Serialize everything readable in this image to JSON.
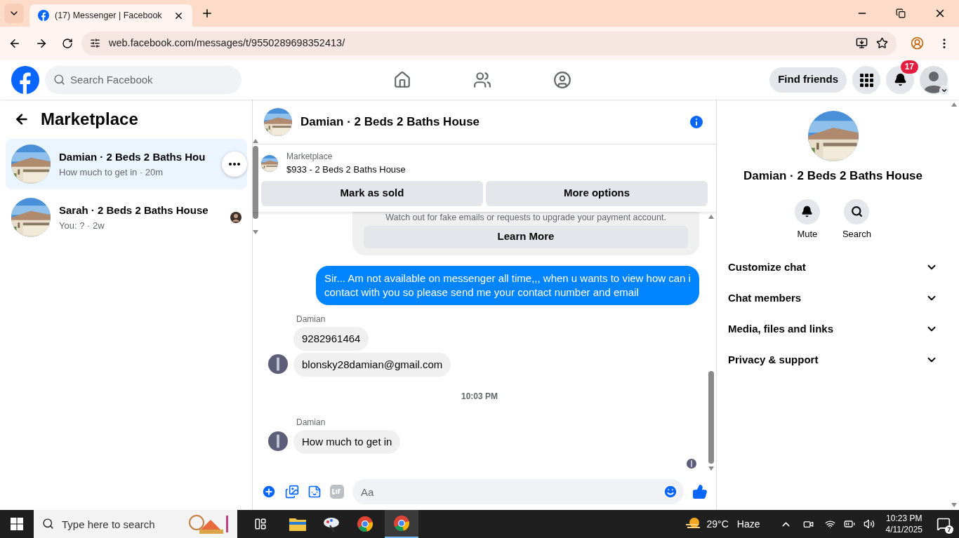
{
  "browser": {
    "tab_title": "(17) Messenger | Facebook",
    "url": "web.facebook.com/messages/t/9550289698352413/"
  },
  "header": {
    "search_placeholder": "Search Facebook",
    "find_friends": "Find friends",
    "notification_count": "17"
  },
  "sidebar": {
    "title": "Marketplace",
    "conversations": [
      {
        "name": "Damian · 2 Beds 2 Baths Hou",
        "preview": "How much to get in · 20m",
        "selected": true
      },
      {
        "name": "Sarah · 2 Beds 2 Baths House",
        "preview": "You: ? · 2w",
        "selected": false
      }
    ]
  },
  "chat": {
    "title": "Damian · 2 Beds 2 Baths House",
    "listing": {
      "label": "Marketplace",
      "item": "$933 - 2 Beds 2 Baths House"
    },
    "actions": [
      "Mark as sold",
      "More options"
    ],
    "warning": {
      "text": "Watch out for fake emails or requests to upgrade your payment account.",
      "button": "Learn More"
    },
    "messages": [
      {
        "kind": "sent",
        "text": "Sir... Am not available on messenger all time,,, when u wants to view how can i contact with you so please send me your contact number and email"
      },
      {
        "kind": "name",
        "text": "Damian"
      },
      {
        "kind": "received",
        "text": "9282961464",
        "avatar": false
      },
      {
        "kind": "received",
        "text": "blonsky28damian@gmail.com",
        "avatar": true
      },
      {
        "kind": "time",
        "text": "10:03 PM"
      },
      {
        "kind": "name",
        "text": "Damian"
      },
      {
        "kind": "received",
        "text": "How much to get in",
        "avatar": true
      }
    ],
    "composer_placeholder": "Aa"
  },
  "details": {
    "name": "Damian · 2 Beds 2 Baths House",
    "actions": [
      {
        "kind": "mute",
        "label": "Mute"
      },
      {
        "kind": "search",
        "label": "Search"
      }
    ],
    "sections": [
      "Customize chat",
      "Chat members",
      "Media, files and links",
      "Privacy & support"
    ]
  },
  "taskbar": {
    "search_placeholder": "Type here to search",
    "temperature": "29°C",
    "weather": "Haze",
    "time": "10:23 PM",
    "date": "4/11/2025",
    "notification_count": "7"
  }
}
